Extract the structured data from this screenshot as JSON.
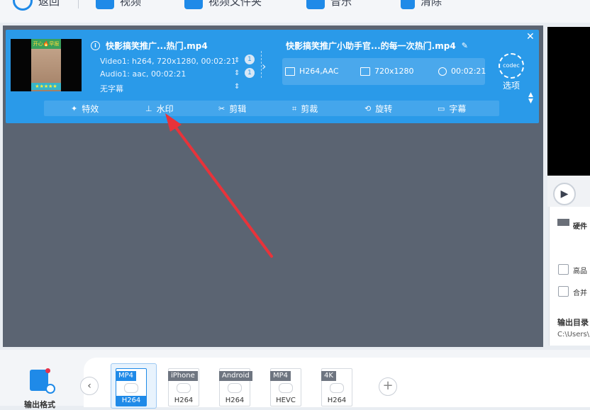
{
  "toolbar": {
    "back_label": "返回",
    "add_video_label": "视频",
    "add_folder_label": "视频文件夹",
    "add_music_label": "音乐",
    "clear_label": "清除"
  },
  "task": {
    "source_title": "快影搞笑推广...热门.mp4",
    "video_line": "Video1: h264, 720x1280, 00:02:21",
    "audio_line": "Audio1: aac, 00:02:21",
    "subtitle_line": "无字幕",
    "video_track_count": "1",
    "audio_track_count": "1",
    "output_title": "快影搞笑推广小助手官...的每一次热门.mp4",
    "output_codec": "H264,AAC",
    "output_resolution": "720x1280",
    "output_duration": "00:02:21",
    "codec_icon_text": "codec",
    "options_label": "选项",
    "thumb_top_text": "开心🔥早报",
    "thumb_bottom_text": "★★★★★"
  },
  "actions": {
    "effects": "特效",
    "watermark": "水印",
    "clip": "剪辑",
    "crop": "剪裁",
    "rotate": "旋转",
    "subtitle": "字幕"
  },
  "right_panel": {
    "hardware_label": "硬件",
    "high_quality_label": "高品",
    "merge_label": "合并",
    "output_dir_label": "输出目录",
    "output_path": "C:\\Users\\"
  },
  "bottom": {
    "output_format_label": "输出格式",
    "formats": [
      {
        "tag": "MP4",
        "codec": "H264"
      },
      {
        "tag": "iPhone",
        "codec": "H264"
      },
      {
        "tag": "Android",
        "codec": "H264"
      },
      {
        "tag": "MP4",
        "codec": "HEVC"
      },
      {
        "tag": "4K",
        "codec": "H264"
      }
    ]
  },
  "colors": {
    "accent": "#1f8ae8",
    "card": "#2a9ae9",
    "workspace": "#5b6472",
    "annotation_arrow": "#e8333a"
  }
}
